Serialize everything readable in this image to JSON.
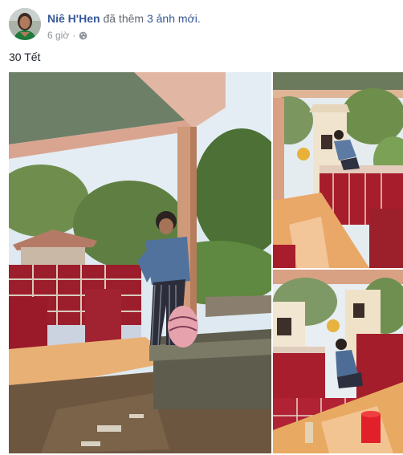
{
  "post": {
    "author": "Niê H'Hen",
    "action_text": "đã thêm",
    "action_link": "3 ảnh mới.",
    "time": "6 giờ",
    "separator": "·",
    "privacy_icon": "globe-icon",
    "text": "30 Tết"
  },
  "photos": [
    {
      "name": "photo-main",
      "subject": "man-at-grave-outdoor"
    },
    {
      "name": "photo-top-right",
      "subject": "man-cleaning-tomb"
    },
    {
      "name": "photo-bottom-right",
      "subject": "person-kneeling-by-tomb"
    }
  ],
  "colors": {
    "link": "#365899",
    "meta": "#90949c",
    "text": "#1d2129"
  }
}
